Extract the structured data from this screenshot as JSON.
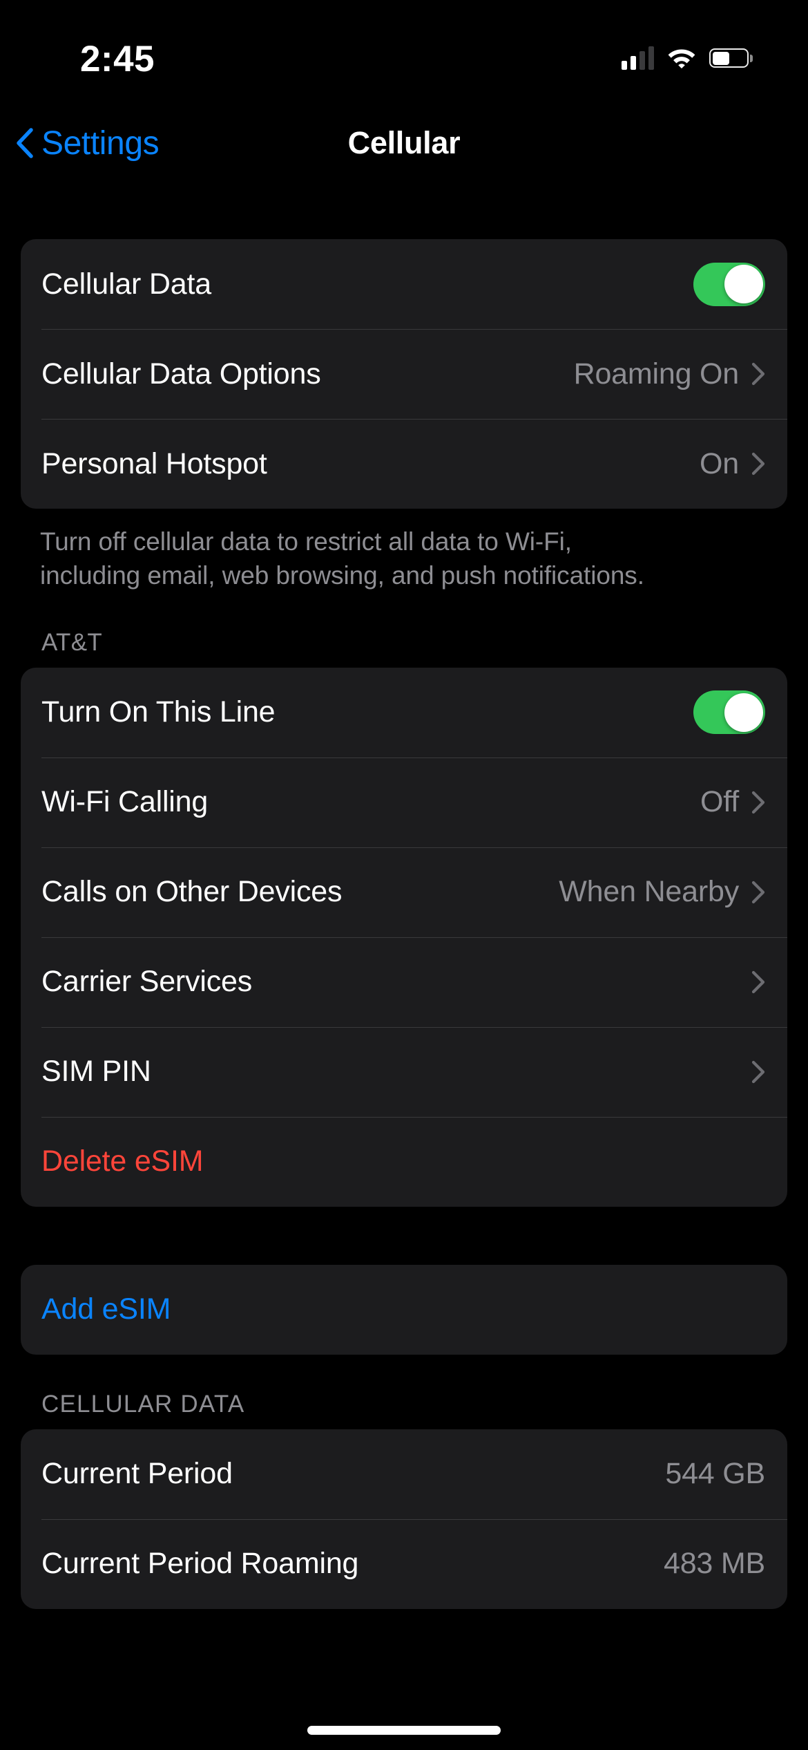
{
  "status_bar": {
    "time": "2:45",
    "cellular_bars_filled": 2,
    "cellular_bars_total": 4,
    "wifi_icon": "wifi-icon",
    "battery_icon": "battery-icon",
    "battery_level_pct": 45
  },
  "nav": {
    "back_label": "Settings",
    "back_icon": "chevron-left-icon",
    "title": "Cellular"
  },
  "colors": {
    "accent_blue": "#0a84ff",
    "destructive_red": "#ff453a",
    "toggle_on_green": "#34c759",
    "secondary_text": "#8e8e93",
    "card_background": "#1c1c1e",
    "page_background": "#000000"
  },
  "group_data": {
    "rows": [
      {
        "label": "Cellular Data",
        "control": "toggle",
        "toggle_on": true
      },
      {
        "label": "Cellular Data Options",
        "value": "Roaming On",
        "control": "chevron"
      },
      {
        "label": "Personal Hotspot",
        "value": "On",
        "control": "chevron"
      }
    ],
    "footer": "Turn off cellular data to restrict all data to Wi-Fi, including email, web browsing, and push notifications."
  },
  "group_line": {
    "header": "AT&T",
    "rows": [
      {
        "label": "Turn On This Line",
        "control": "toggle",
        "toggle_on": true
      },
      {
        "label": "Wi-Fi Calling",
        "value": "Off",
        "control": "chevron"
      },
      {
        "label": "Calls on Other Devices",
        "value": "When Nearby",
        "control": "chevron"
      },
      {
        "label": "Carrier Services",
        "value": "",
        "control": "chevron"
      },
      {
        "label": "SIM PIN",
        "value": "",
        "control": "chevron"
      },
      {
        "label": "Delete eSIM",
        "value": "",
        "control": "none",
        "style": "red"
      }
    ]
  },
  "group_add": {
    "rows": [
      {
        "label": "Add eSIM",
        "style": "blue"
      }
    ]
  },
  "group_usage": {
    "header": "CELLULAR DATA",
    "rows": [
      {
        "label": "Current Period",
        "value": "544 GB"
      },
      {
        "label": "Current Period Roaming",
        "value": "483 MB"
      }
    ]
  }
}
